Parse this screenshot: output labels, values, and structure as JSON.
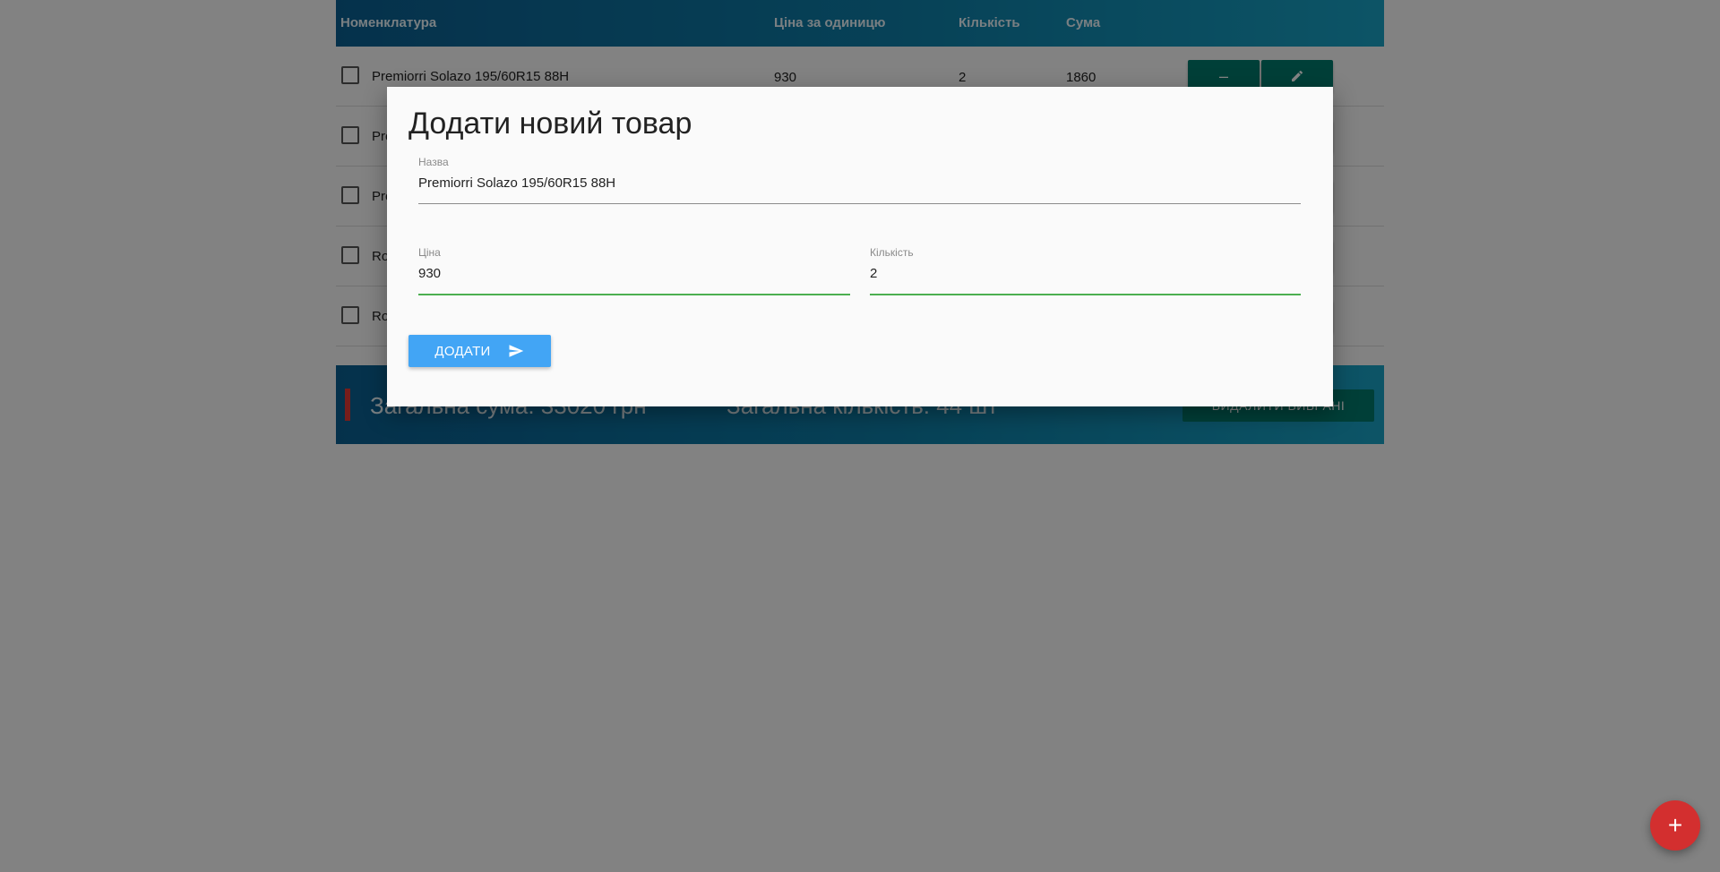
{
  "table": {
    "headers": {
      "name": "Номенклатура",
      "price": "Ціна за одиницю",
      "qty": "Кількість",
      "sum": "Сума"
    },
    "rows": [
      {
        "name": "Premiorri Solazo 195/60R15 88H",
        "price": "930",
        "qty": "2",
        "sum": "1860"
      },
      {
        "name": "Pre",
        "price": "",
        "qty": "",
        "sum": ""
      },
      {
        "name": "Pre",
        "price": "",
        "qty": "",
        "sum": ""
      },
      {
        "name": "Ro",
        "price": "",
        "qty": "",
        "sum": ""
      },
      {
        "name": "Ro",
        "price": "",
        "qty": "",
        "sum": ""
      }
    ],
    "row_buttons": {
      "minus": "–",
      "edit_icon": "pencil-icon"
    }
  },
  "footer": {
    "total_sum": "Загальна сума: 33020 грн",
    "total_qty": "Загальна кількість: 44 шт",
    "delete_button": "ВИДАЛИТИ ВИБРАНІ"
  },
  "modal": {
    "title": "Додати новий товар",
    "name_label": "Назва",
    "name_value": "Premiorri Solazo 195/60R15 88H",
    "price_label": "Ціна",
    "price_value": "930",
    "qty_label": "Кількість",
    "qty_value": "2",
    "add_button": "ДОДАТИ",
    "add_icon": "send-icon"
  },
  "fab": {
    "label": "+",
    "icon": "plus-icon"
  },
  "colors": {
    "header_gradient_start": "#0b5f91",
    "header_gradient_end": "#19a2c4",
    "action_teal": "#00796b",
    "add_button_blue": "#42a5f5",
    "fab_red": "#d32f2f",
    "field_focus_green": "#4caf50"
  }
}
